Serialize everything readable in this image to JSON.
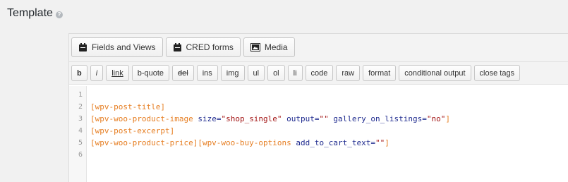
{
  "header": {
    "title": "Template",
    "help_icon": "question-icon"
  },
  "toolbar_main": [
    {
      "id": "fields-views",
      "label": "Fields and Views",
      "icon": "toolset-icon"
    },
    {
      "id": "cred-forms",
      "label": "CRED forms",
      "icon": "toolset-icon"
    },
    {
      "id": "media",
      "label": "Media",
      "icon": "image-icon"
    }
  ],
  "toolbar_format": [
    "b",
    "i",
    "link",
    "b-quote",
    "del",
    "ins",
    "img",
    "ul",
    "ol",
    "li",
    "code",
    "raw",
    "format",
    "conditional output",
    "close tags"
  ],
  "code": {
    "line_numbers": [
      "1",
      "2",
      "3",
      "4",
      "5",
      "6"
    ],
    "line2": {
      "shortcode": "[wpv-post-title]"
    },
    "line3": {
      "shortcode": "[wpv-woo-product-image",
      "attr1": "size=",
      "val1": "\"shop_single\"",
      "attr2": "output=",
      "val2": "\"\"",
      "attr3": "gallery_on_listings=",
      "val3": "\"no\"",
      "close": "]"
    },
    "line4": {
      "shortcode": "[wpv-post-excerpt]"
    },
    "line5": {
      "shortcode": "[wpv-woo-product-price][wpv-woo-buy-options",
      "attr1": "add_to_cart_text=",
      "val1": "\"\"",
      "close": "]"
    }
  }
}
